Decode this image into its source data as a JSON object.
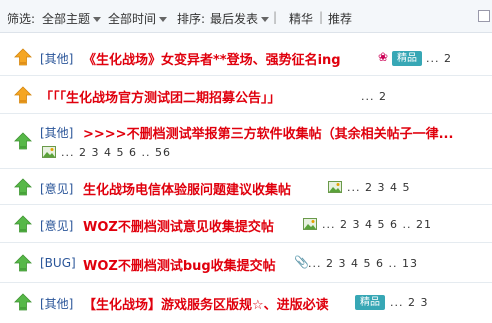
{
  "filter": {
    "label": "筛选:",
    "topics": "全部主题",
    "time": "全部时间",
    "sort_label": "排序:",
    "sort_value": "最后发表",
    "separator": "|",
    "essence": "精华",
    "recommend": "推荐"
  },
  "badges": {
    "jinghua": "精品"
  },
  "colors": {
    "title_red": "#e0000d",
    "category_blue": "#2a5599",
    "pin_orange": "#f5a623",
    "arrow_green": "#57b848"
  },
  "threads": [
    {
      "category": "[其他]",
      "title": "《生化战场》女变异者**登场、强势征名ing",
      "pages": "... 2"
    },
    {
      "category": "",
      "title": "「「「生化战场官方测试团二期招募公告」」",
      "pages": "... 2"
    },
    {
      "category": "[其他]",
      "title": ">>>>不删档测试举报第三方软件收集帖（其余相关帖子一律...",
      "pages": "... 2 3 4 5 6 .. 56"
    },
    {
      "category": "[意见]",
      "title": "生化战场电信体验服问题建议收集帖",
      "pages": "... 2 3 4 5"
    },
    {
      "category": "[意见]",
      "title": "WOZ不删档测试意见收集提交帖",
      "pages": "... 2 3 4 5 6 .. 21"
    },
    {
      "category": "[BUG]",
      "title": "WOZ不删档测试bug收集提交帖",
      "pages": "... 2 3 4 5 6 .. 13"
    },
    {
      "category": "[其他]",
      "title": "【生化战场】游戏服务区版规☆、进版必读",
      "pages": "... 2 3"
    }
  ]
}
